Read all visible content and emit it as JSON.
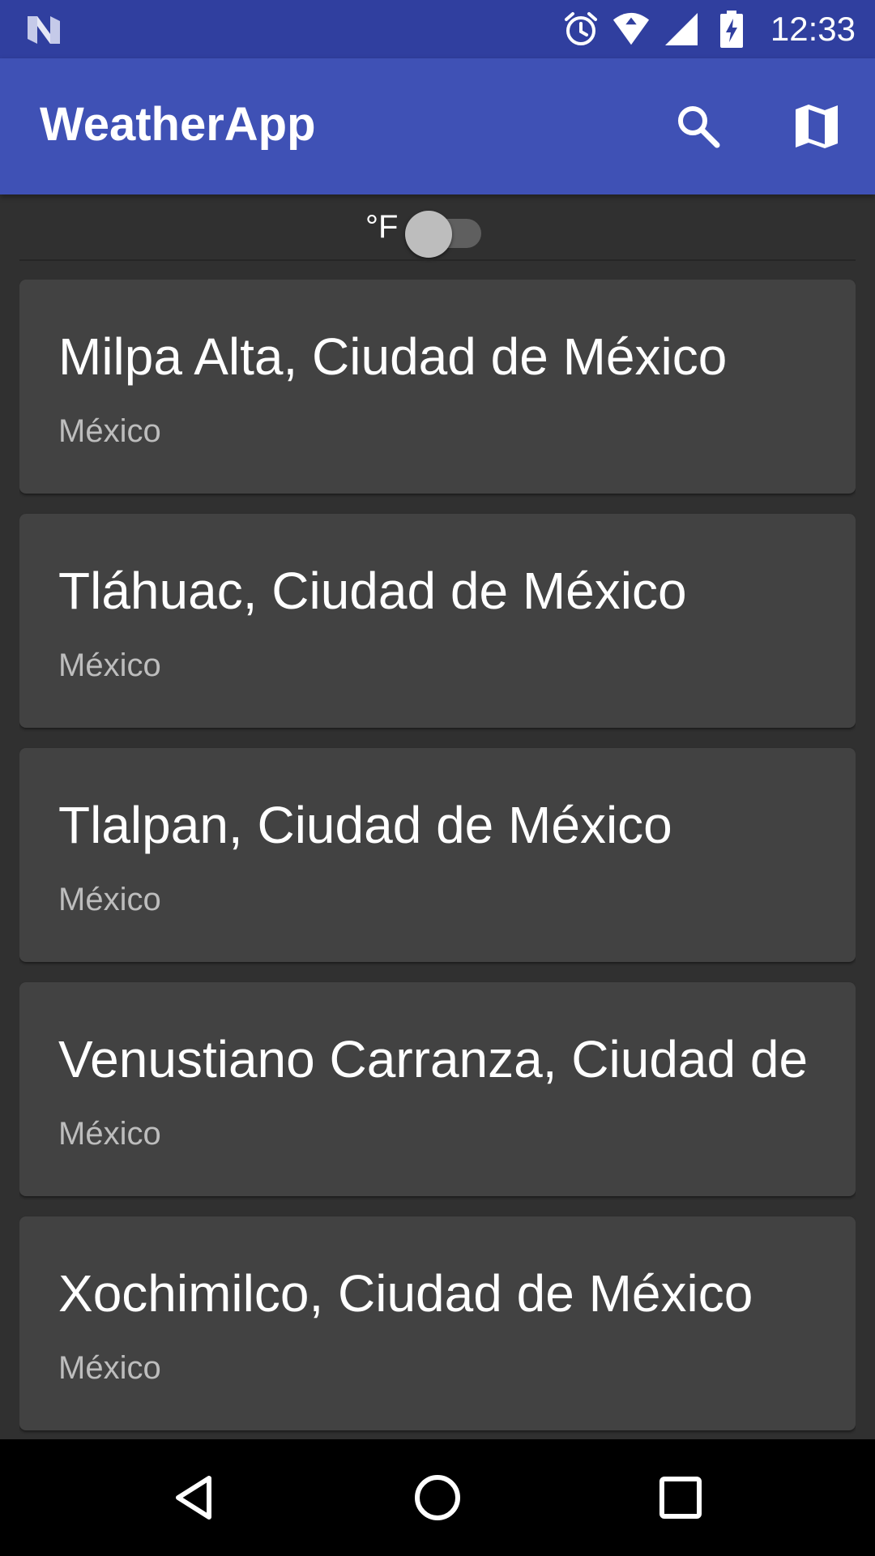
{
  "status_bar": {
    "time": "12:33",
    "icons": [
      "android-n-icon",
      "alarm-icon",
      "wifi-icon",
      "signal-icon",
      "battery-charging-icon"
    ]
  },
  "app_bar": {
    "title": "WeatherApp",
    "actions": [
      "search-icon",
      "map-icon"
    ],
    "color": "#3f51b5",
    "status_color": "#303f9f"
  },
  "unit_toggle": {
    "label": "°F",
    "checked": false
  },
  "cities": [
    {
      "name": "Milpa Alta, Ciudad de México",
      "country": "México"
    },
    {
      "name": "Tláhuac, Ciudad de México",
      "country": "México"
    },
    {
      "name": "Tlalpan, Ciudad de México",
      "country": "México"
    },
    {
      "name": "Venustiano Carranza, Ciudad de",
      "country": "México"
    },
    {
      "name": "Xochimilco, Ciudad de México",
      "country": "México"
    }
  ],
  "nav_bar": {
    "buttons": [
      "back-icon",
      "home-icon",
      "recents-icon"
    ]
  }
}
